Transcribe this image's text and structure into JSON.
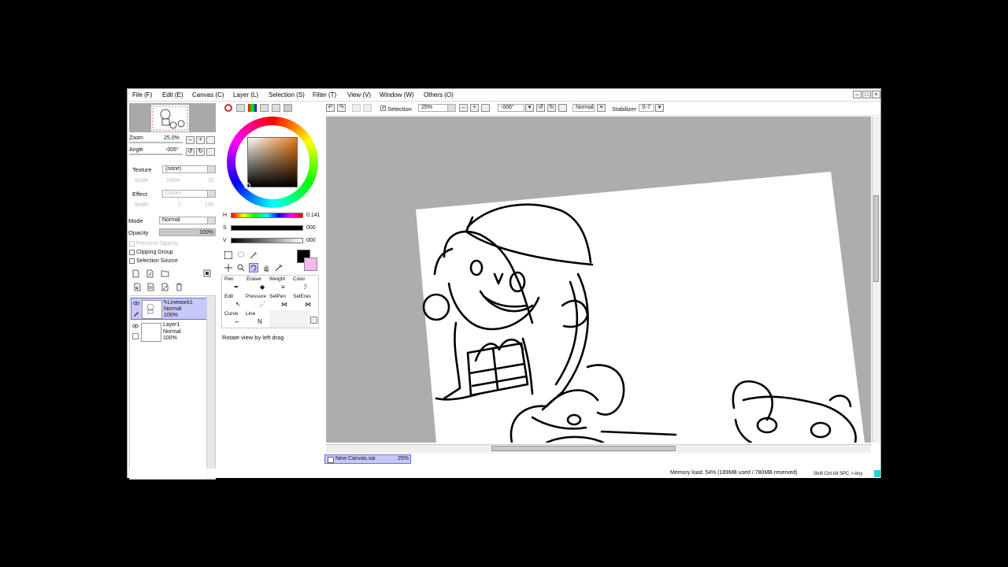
{
  "menu": [
    "File (F)",
    "Edit (E)",
    "Canvas (C)",
    "Layer (L)",
    "Selection (S)",
    "Filter (T)",
    "View (V)",
    "Window (W)",
    "Others (O)"
  ],
  "navigator": {
    "zoom_label": "Zoom",
    "zoom_value": "25.0%",
    "angle_label": "Angle",
    "angle_value": "-005°"
  },
  "texture": {
    "label": "Texture",
    "value": "(none)",
    "scale_label": "Scale",
    "scale_value": "100%",
    "scale_num": "20"
  },
  "effect": {
    "label": "Effect",
    "value": "(none)",
    "width_label": "Width",
    "width_value": "1",
    "width_num": "100"
  },
  "mode": {
    "label": "Mode",
    "value": "Normal"
  },
  "opacity": {
    "label": "Opacity",
    "value": "100%"
  },
  "checks": {
    "preserve_opacity": "Preserve Opacity",
    "clipping_group": "Clipping Group",
    "selection_source": "Selection Source"
  },
  "layers": [
    {
      "name": "Linework1",
      "mode": "Normal",
      "opacity": "100%"
    },
    {
      "name": "Layer1",
      "mode": "Normal",
      "opacity": "100%"
    }
  ],
  "hsv": {
    "h_label": "H",
    "h_value": "0:141",
    "s_label": "S",
    "s_value": "000",
    "v_label": "V",
    "v_value": "000"
  },
  "colors": {
    "primary": "#000000",
    "secondary": "#f7b6ee",
    "selected_layer_bg": "#c8c8f8",
    "canvas_bg": "#adadad"
  },
  "tools": {
    "row1": [
      "Pen",
      "Eraser",
      "Weight",
      "Color"
    ],
    "row2": [
      "Edit",
      "Pressure",
      "SelPen",
      "SelEras"
    ],
    "row3": [
      "Curve",
      "Line"
    ]
  },
  "status_hint": "Rotate view by left drag",
  "toolbar": {
    "selection_label": "Selection",
    "zoom": "25%",
    "angle": "-006°",
    "blend": "Normal",
    "stabilizer_label": "Stabilizer",
    "stabilizer_value": "S-7"
  },
  "document_tab": {
    "name": "New Canvas.sai",
    "zoom": "25%"
  },
  "statusbar": {
    "memory": "Memory load: 54% (189MB used / 780MB reserved)",
    "keys": "Shift Ctrl Alt SPC ✧Any"
  }
}
